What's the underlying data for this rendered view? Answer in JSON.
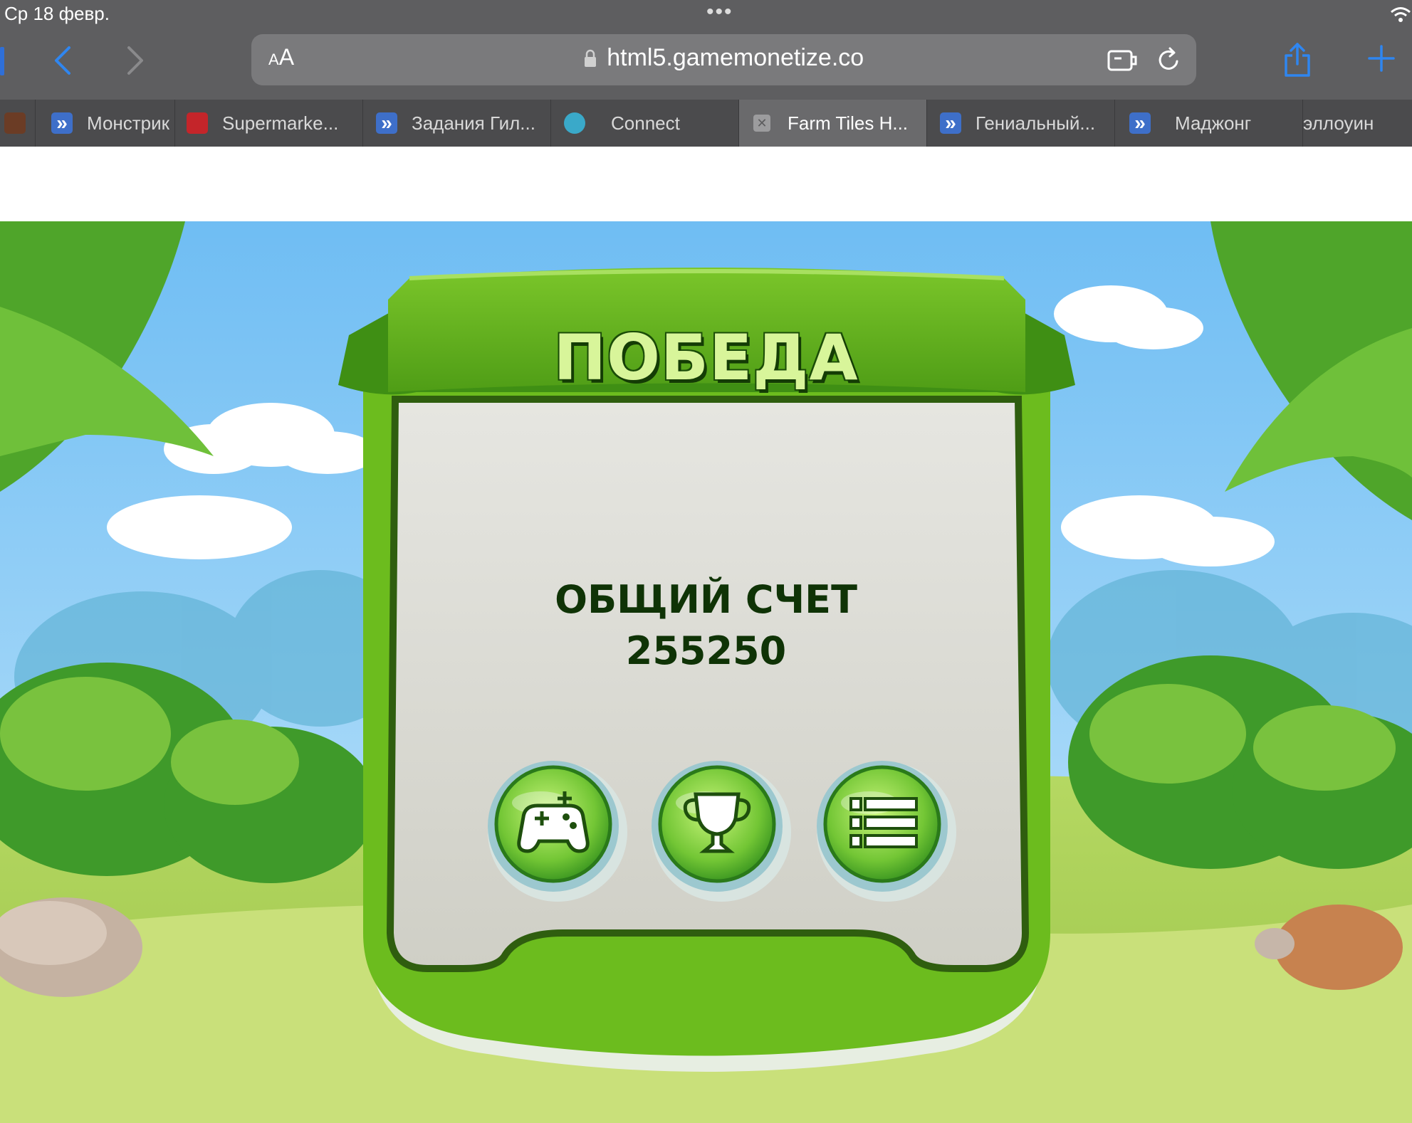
{
  "status_bar": {
    "date": "Ср 18 февр.",
    "dots": "•••"
  },
  "toolbar": {
    "reader_label_small": "A",
    "reader_label_large": "A",
    "url": "html5.gamemonetize.co"
  },
  "tabs": [
    {
      "label": "",
      "icon": "game-favicon-dark"
    },
    {
      "label": "Монстрик",
      "icon": "blue-arrows-favicon"
    },
    {
      "label": "Supermarke...",
      "icon": "peas-can-favicon"
    },
    {
      "label": "Задания Гил...",
      "icon": "blue-arrows-favicon"
    },
    {
      "label": "Connect",
      "icon": "snow-globe-favicon"
    },
    {
      "label": "Farm Tiles H...",
      "icon": "close-icon",
      "active": true
    },
    {
      "label": "Гениальный...",
      "icon": "blue-arrows-favicon"
    },
    {
      "label": "Маджонг",
      "icon": "blue-arrows-favicon"
    },
    {
      "label": "эллоуин",
      "icon": ""
    }
  ],
  "game": {
    "title": "ПОБЕДА",
    "score_label": "ОБЩИЙ СЧЕТ",
    "score_value": "255250",
    "buttons": [
      "gamepad-icon",
      "trophy-icon",
      "list-icon"
    ]
  },
  "colors": {
    "sky": "#83c7f3",
    "panel_green": "#6cbc1e",
    "panel_inner": "#dcdcd4",
    "title_text": "#d8f59a",
    "score_text": "#0f3306",
    "browser_chrome": "#5e5e60",
    "accent_blue": "#2f86f0"
  }
}
